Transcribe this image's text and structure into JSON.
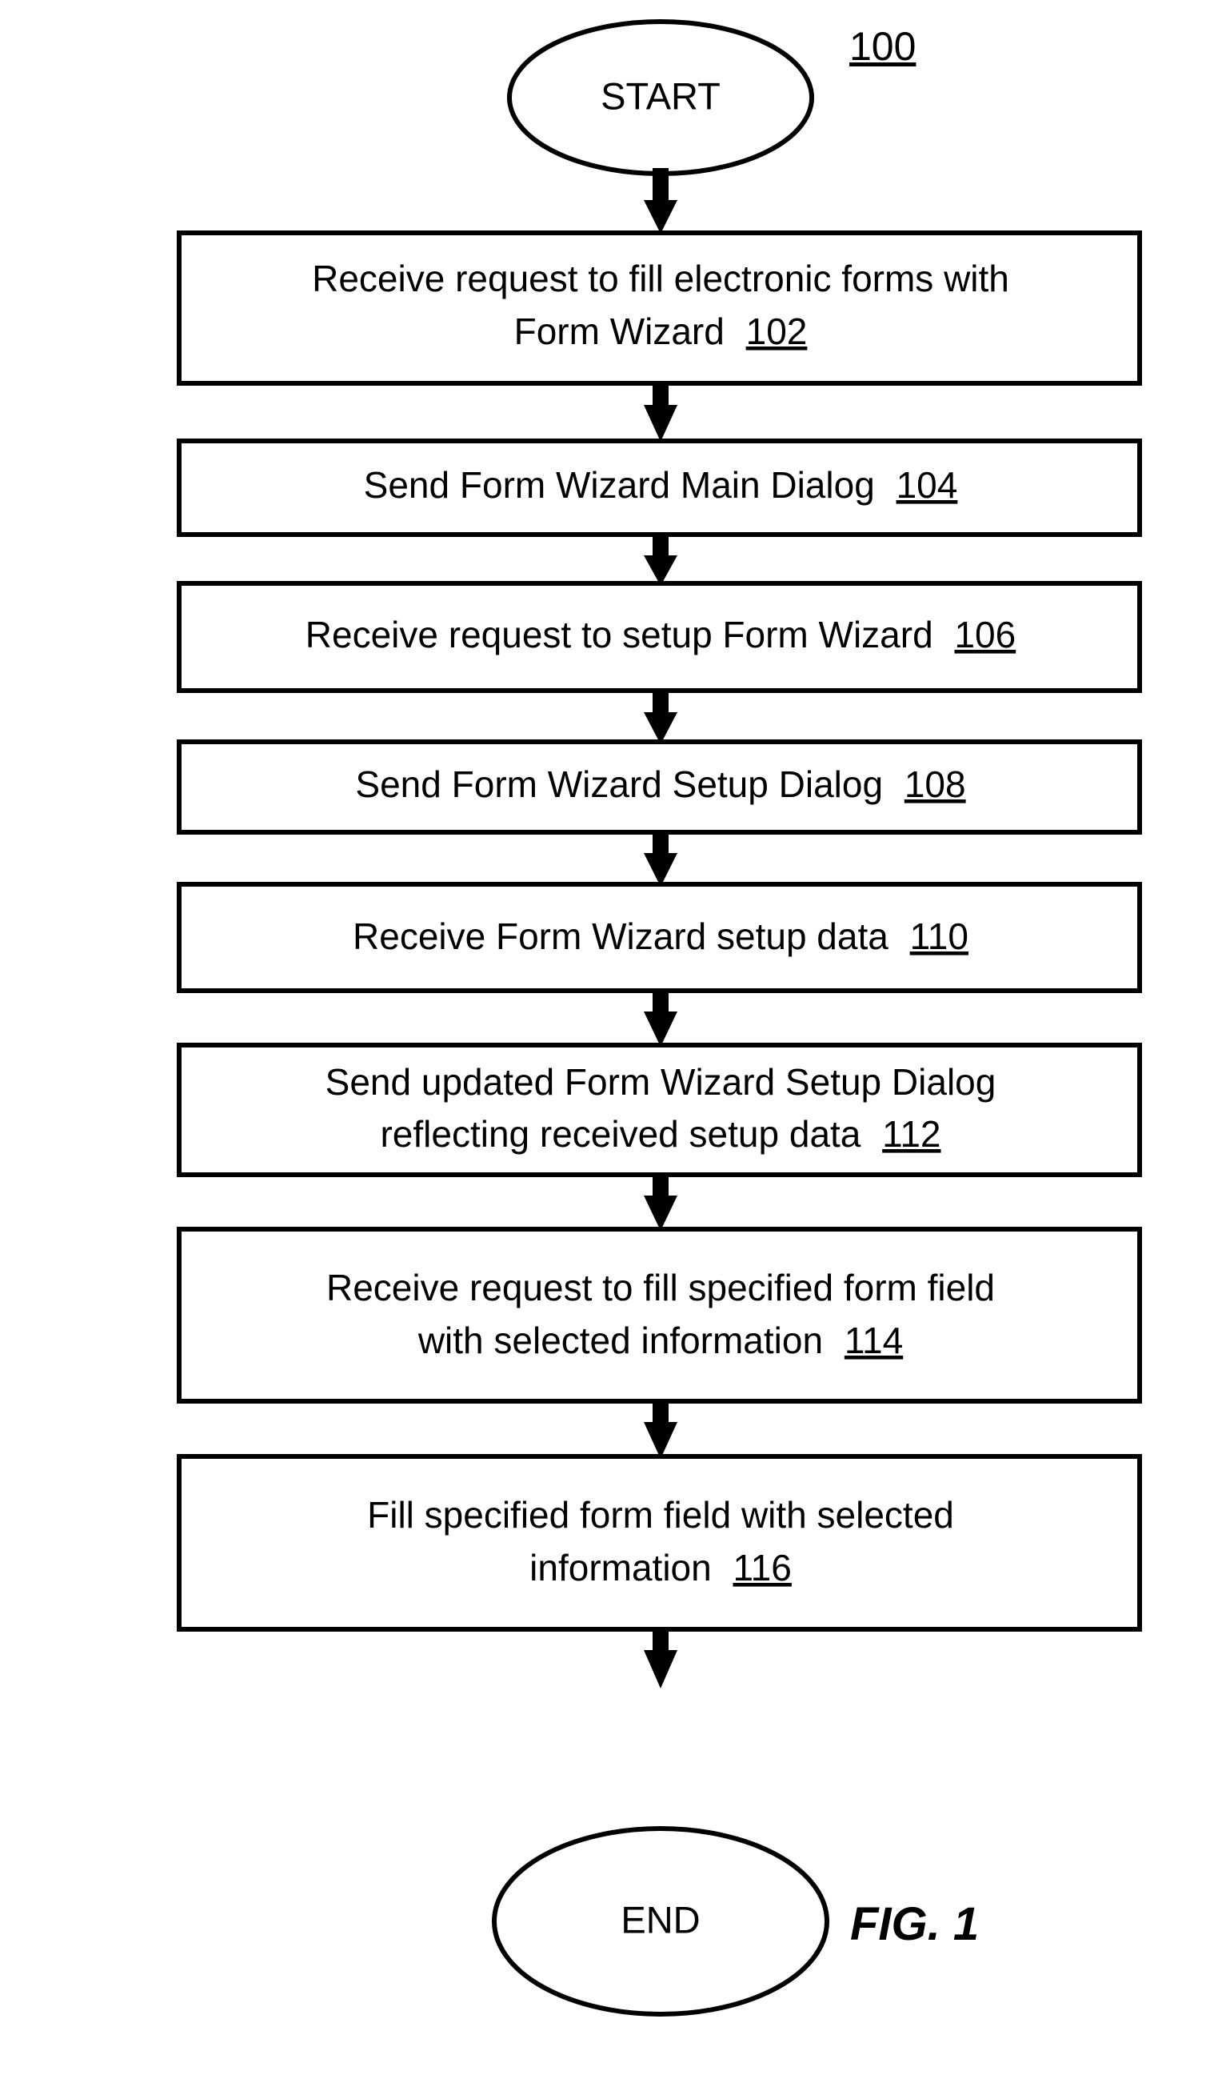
{
  "figure": {
    "caption": "FIG. 1",
    "reference_number": "100"
  },
  "flowchart": {
    "start_node": {
      "label": "START"
    },
    "end_node": {
      "label": "END"
    },
    "steps": [
      {
        "lines": [
          "Receive request to fill electronic forms with",
          "Form Wizard"
        ],
        "ref": "102"
      },
      {
        "lines": [
          "Send Form Wizard Main Dialog"
        ],
        "ref": "104"
      },
      {
        "lines": [
          "Receive request to setup Form Wizard"
        ],
        "ref": "106"
      },
      {
        "lines": [
          "Send Form Wizard Setup Dialog"
        ],
        "ref": "108"
      },
      {
        "lines": [
          "Receive Form Wizard setup data"
        ],
        "ref": "110"
      },
      {
        "lines": [
          "Send updated Form Wizard Setup Dialog",
          "reflecting received setup data"
        ],
        "ref": "112"
      },
      {
        "lines": [
          "Receive request to fill specified form field",
          "with selected information"
        ],
        "ref": "114"
      },
      {
        "lines": [
          "Fill specified form field with selected",
          "information"
        ],
        "ref": "116"
      }
    ]
  },
  "step_text": {
    "s102_l0": "Receive request to fill electronic forms with",
    "s102_l1": "Form Wizard",
    "s102_ref": "102",
    "s104_l0": "Send Form Wizard Main Dialog",
    "s104_ref": "104",
    "s106_l0": "Receive request to setup Form Wizard",
    "s106_ref": "106",
    "s108_l0": "Send Form Wizard Setup Dialog",
    "s108_ref": "108",
    "s110_l0": "Receive Form Wizard setup data",
    "s110_ref": "110",
    "s112_l0": "Send updated Form Wizard Setup Dialog",
    "s112_l1": "reflecting received setup data",
    "s112_ref": "112",
    "s114_l0": "Receive request to fill specified form field",
    "s114_l1": "with selected information",
    "s114_ref": "114",
    "s116_l0": "Fill specified form field with selected",
    "s116_l1": "information",
    "s116_ref": "116"
  },
  "colors": {
    "ink": "#000000",
    "paper": "#ffffff"
  }
}
